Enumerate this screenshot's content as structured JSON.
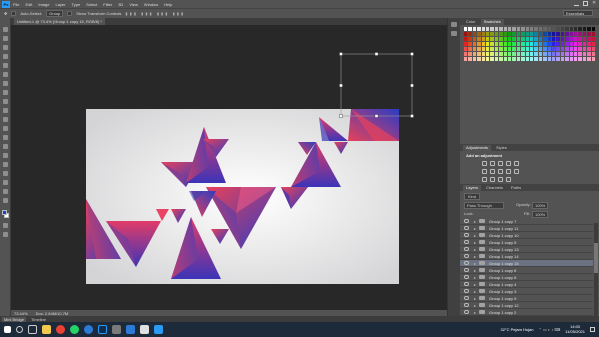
{
  "app": {
    "logo": "Ps"
  },
  "menu": [
    "File",
    "Edit",
    "Image",
    "Layer",
    "Type",
    "Select",
    "Filter",
    "3D",
    "View",
    "Window",
    "Help"
  ],
  "options": {
    "auto_select_label": "Auto-Select:",
    "auto_select_value": "Group",
    "show_transform_label": "Show Transform Controls",
    "workspace": "Essentials"
  },
  "document": {
    "tab_title": "Untitled-1 @ 73.4% (Group 1 copy 15, RGB/8) *"
  },
  "status": {
    "zoom": "73.44%",
    "doc_size": "Doc: 2.64M/10.7M"
  },
  "bottom_tabs": [
    "Mini Bridge",
    "Timeline"
  ],
  "panels": {
    "color_tabs": [
      "Color",
      "Swatches"
    ],
    "adjust_tabs": [
      "Adjustments",
      "Styles"
    ],
    "adjust_title": "Add an adjustment",
    "layers_tabs": [
      "Layers",
      "Channels",
      "Paths"
    ],
    "kind_label": "Kind",
    "blend_mode": "Pass Through",
    "opacity_label": "Opacity:",
    "opacity_value": "100%",
    "lock_label": "Lock:",
    "fill_label": "Fill:",
    "fill_value": "100%"
  },
  "layers": [
    "Group 1 copy 7",
    "Group 1 copy 11",
    "Group 1 copy 10",
    "Group 1 copy 5",
    "Group 1 copy 13",
    "Group 1 copy 14",
    "Group 1 copy 15",
    "Group 1 copy 6",
    "Group 1 copy 8",
    "Group 1 copy 4",
    "Group 1 copy 3",
    "Group 1 copy 9",
    "Group 1 copy 12",
    "Group 1 copy 2",
    "Group 1 copy",
    "Group 1"
  ],
  "selected_layer": "Group 1 copy 15",
  "taskbar": {
    "weather": "32°C  Pejam Hujan",
    "time": "14:00",
    "date": "11/05/2021"
  },
  "colors": {
    "accent": "#2b9af3",
    "gradient_start": "#2a3cc4",
    "gradient_end": "#e8415a"
  }
}
